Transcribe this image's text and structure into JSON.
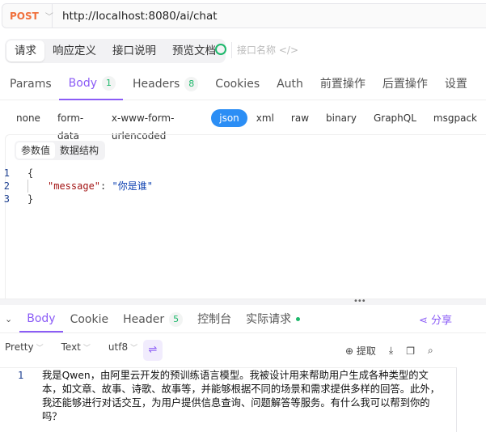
{
  "request": {
    "method": "POST",
    "url": "http://localhost:8080/ai/chat"
  },
  "top_tabs": [
    {
      "label": "请求",
      "active": true
    },
    {
      "label": "响应定义"
    },
    {
      "label": "接口说明"
    },
    {
      "label": "预览文档"
    }
  ],
  "api_name_placeholder": "接口名称",
  "param_tabs": [
    {
      "label": "Params"
    },
    {
      "label": "Body",
      "badge": "1",
      "active": true
    },
    {
      "label": "Headers",
      "badge": "8"
    },
    {
      "label": "Cookies"
    },
    {
      "label": "Auth"
    },
    {
      "label": "前置操作"
    },
    {
      "label": "后置操作"
    },
    {
      "label": "设置"
    }
  ],
  "body_types": [
    "none",
    "form-data",
    "x-www-form-urlencoded",
    "json",
    "xml",
    "raw",
    "binary",
    "GraphQL",
    "msgpack"
  ],
  "body_type_selected": "json",
  "view_seg": [
    "参数值",
    "数据结构"
  ],
  "code": {
    "line_numbers": [
      "1",
      "2",
      "3"
    ],
    "open": "{",
    "key": "\"message\"",
    "colon": ": ",
    "value": "\"你是谁\"",
    "close": "}"
  },
  "response_tabs": [
    {
      "label": "Body",
      "active": true
    },
    {
      "label": "Cookie"
    },
    {
      "label": "Header",
      "badge": "5"
    },
    {
      "label": "控制台"
    },
    {
      "label": "实际请求",
      "status_dot": "#1db86b"
    }
  ],
  "share_label": "分享",
  "toolbar": {
    "format": "Pretty",
    "type": "Text",
    "encoding": "utf8",
    "extract": "提取"
  },
  "response": {
    "line_number": "1",
    "text": "我是Qwen，由阿里云开发的预训练语言模型。我被设计用来帮助用户生成各种类型的文本，如文章、故事、诗歌、故事等，并能够根据不同的场景和需求提供多样的回答。此外，我还能够进行对话交互，为用户提供信息查询、问题解答等服务。有什么我可以帮到你的吗？"
  },
  "colors": {
    "accent": "#8b5cf6",
    "method": "#f0703c",
    "json_active": "#2b8ef5",
    "badge_green": "#1db86b"
  }
}
